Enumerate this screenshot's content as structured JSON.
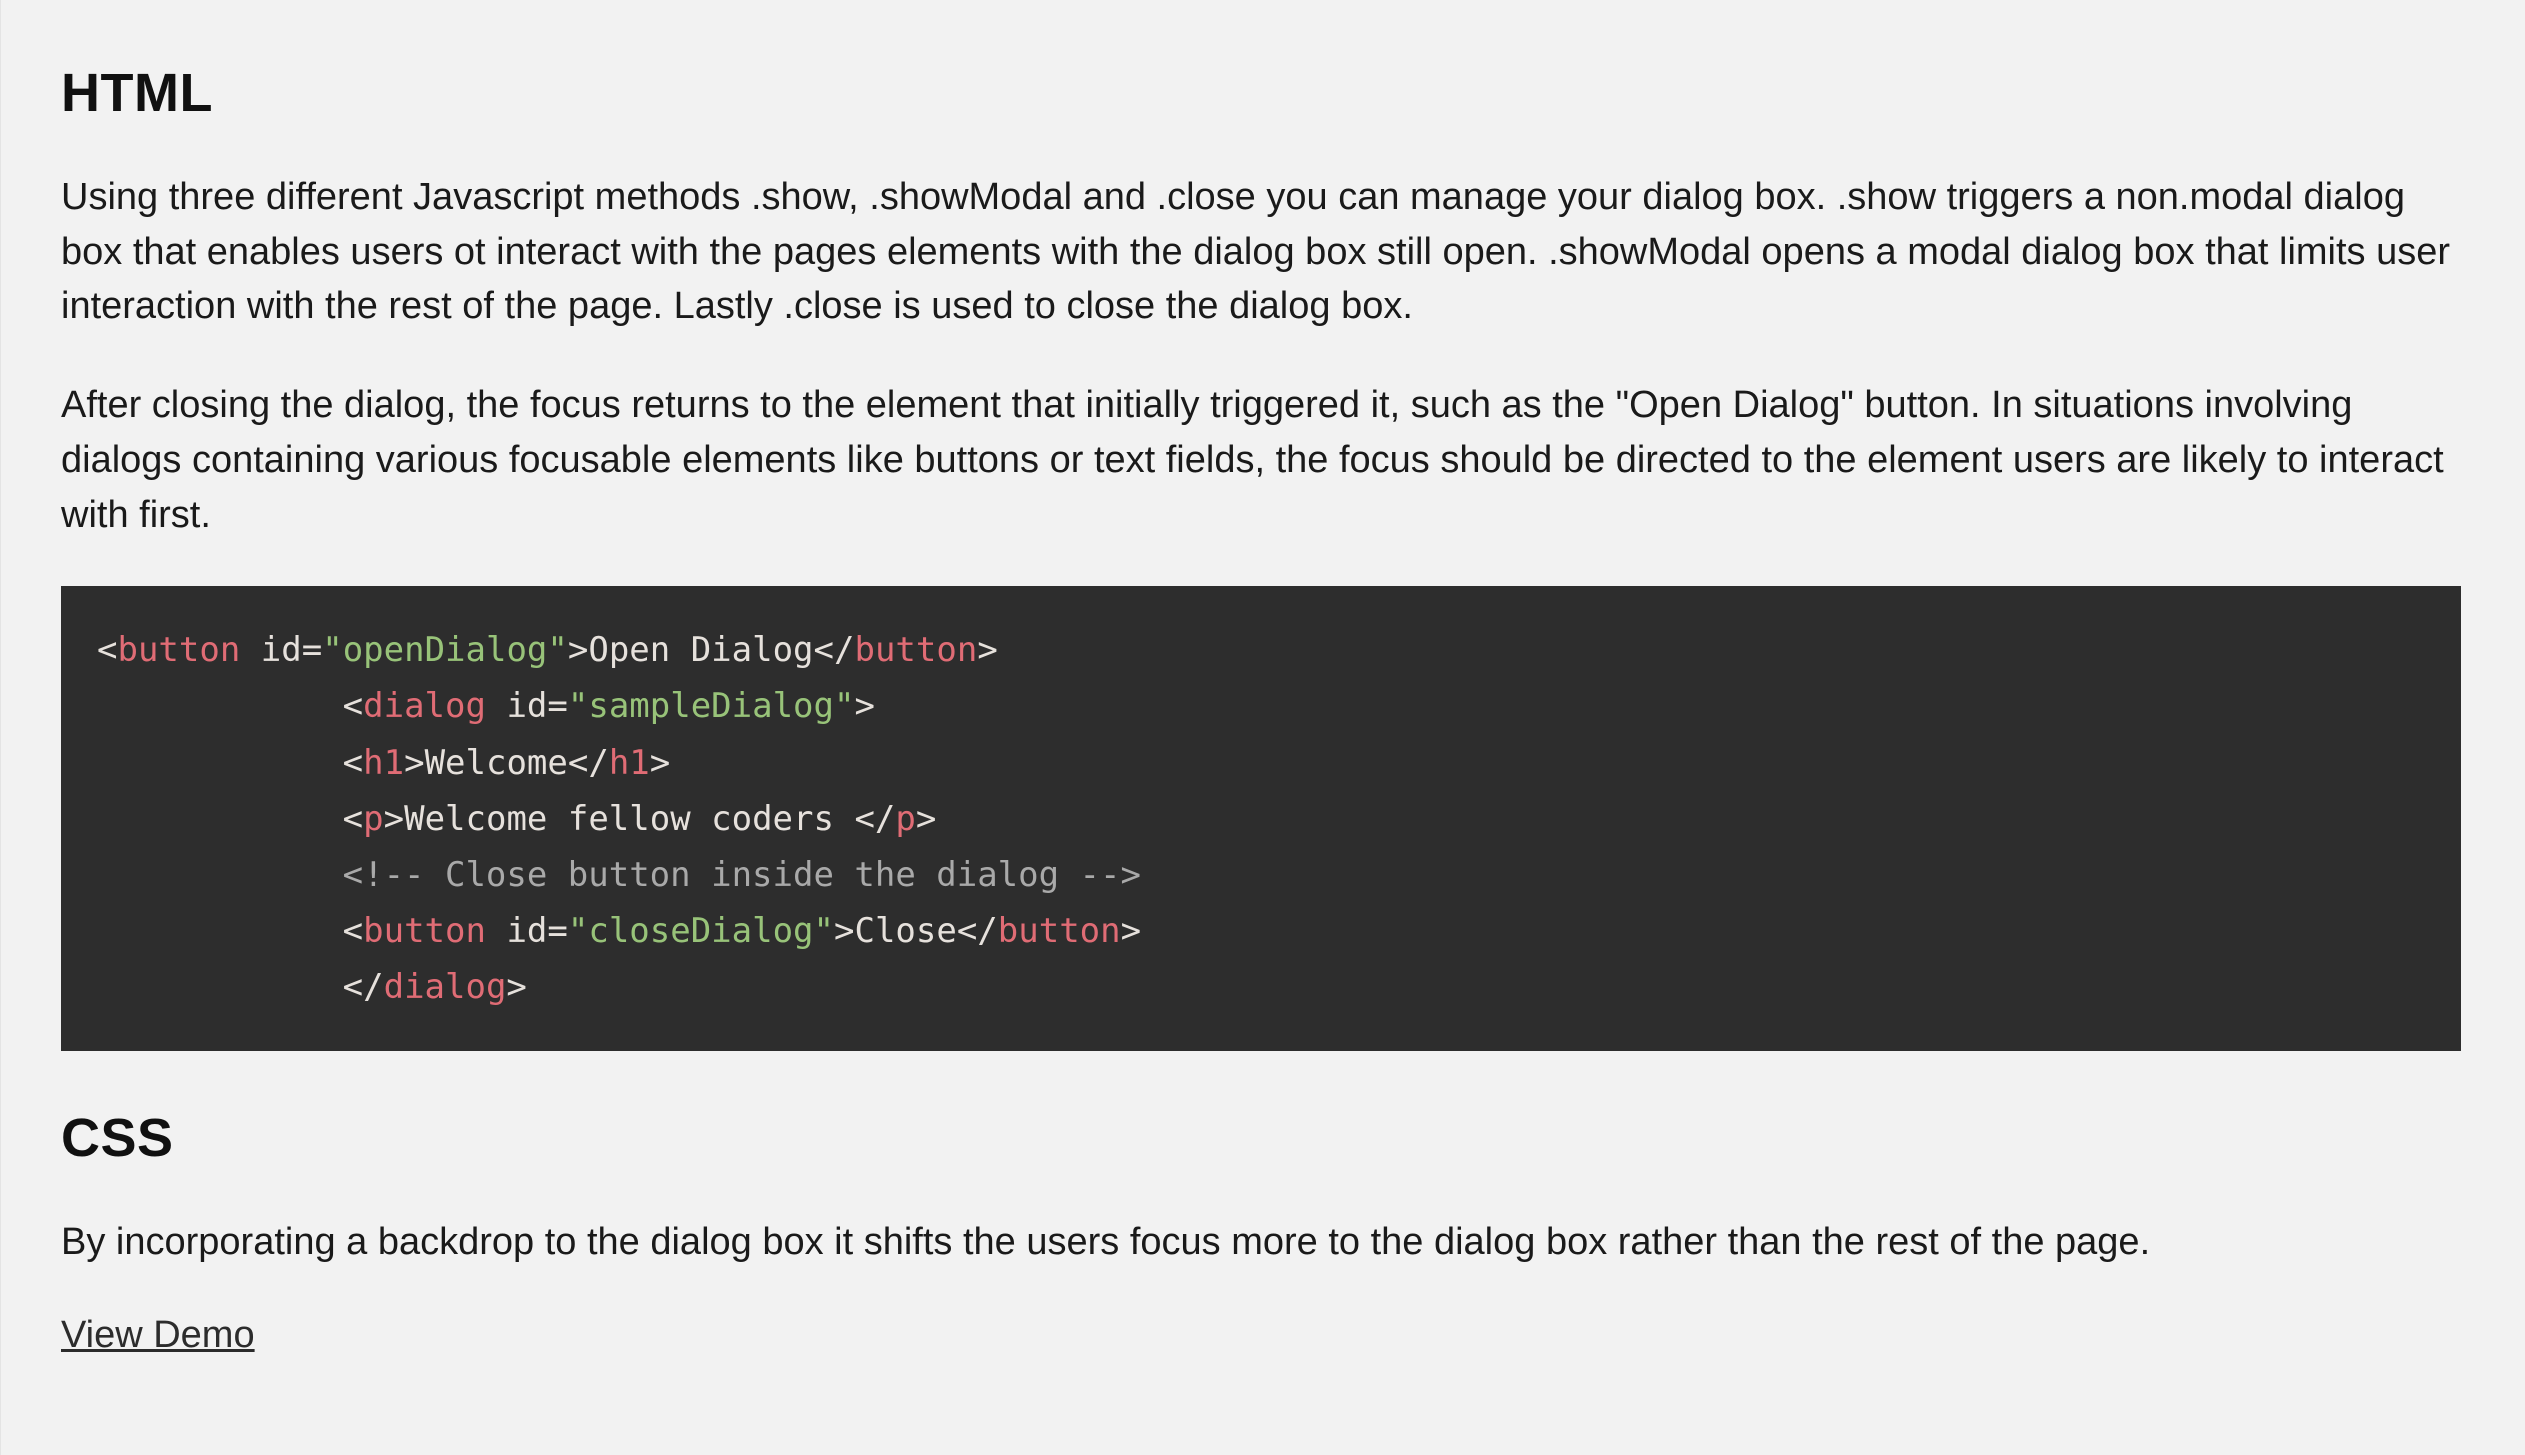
{
  "sections": {
    "html": {
      "heading": "HTML",
      "paragraphs": [
        "Using three different Javascript methods .show, .showModal and .close you can manage your dialog box. .show triggers a non.modal dialog box that enables users ot interact with the pages elements with the dialog box still open. .showModal opens a modal dialog box that limits user interaction with the rest of the page. Lastly .close is used to close the dialog box.",
        "After closing the dialog, the focus returns to the element that initially triggered it, such as the \"Open Dialog\" button. In situations involving dialogs containing various focusable elements like buttons or text fields, the focus should be directed to the element users are likely to interact with first."
      ],
      "code": {
        "line1": {
          "tag": "button",
          "attr": "id",
          "val": "\"openDialog\"",
          "inner": "Open Dialog"
        },
        "line2": {
          "tag": "dialog",
          "attr": "id",
          "val": "\"sampleDialog\""
        },
        "line3": {
          "tag": "h1",
          "inner": "Welcome"
        },
        "line4": {
          "tag": "p",
          "inner": "Welcome fellow coders "
        },
        "line5": {
          "comment": "<!-- Close button inside the dialog -->"
        },
        "line6": {
          "tag": "button",
          "attr": "id",
          "val": "\"closeDialog\"",
          "inner": "Close"
        },
        "line7": {
          "tag": "dialog"
        }
      }
    },
    "css": {
      "heading": "CSS",
      "paragraphs": [
        "By incorporating a backdrop to the dialog box it shifts the users focus more to the dialog box rather than the rest of the page."
      ],
      "demo_link_label": "View Demo"
    }
  }
}
